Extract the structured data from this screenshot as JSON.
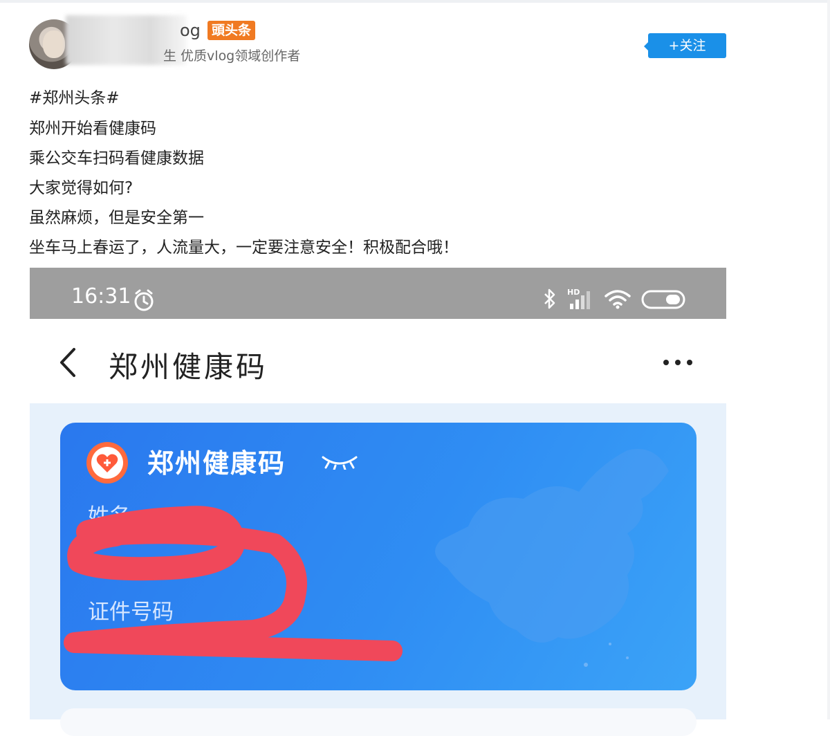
{
  "author": {
    "name_tail": "og",
    "badge": "頭头条",
    "description": "生 优质vlog领域创作者",
    "follow_label": "+关注"
  },
  "post": {
    "lines": [
      "#郑州头条#",
      "郑州开始看健康码",
      "乘公交车扫码看健康数据",
      "大家觉得如何?",
      "虽然麻烦，但是安全第一",
      "坐车马上春运了，人流量大，一定要注意安全！积极配合哦！"
    ]
  },
  "phone": {
    "status_time": "16:31",
    "icons": [
      "alarm-icon",
      "bluetooth-icon",
      "hd-signal-icon",
      "wifi-icon",
      "battery-icon"
    ],
    "page_title": "郑州健康码",
    "card": {
      "title": "郑州健康码",
      "name_label": "姓名",
      "id_label": "证件号码"
    }
  },
  "colors": {
    "accent_blue": "#1a90e8",
    "badge_orange": "#f07a22",
    "card_blue": "#2f8df3",
    "redaction_red": "#f0485a",
    "statusbar_gray": "#9e9e9e"
  }
}
